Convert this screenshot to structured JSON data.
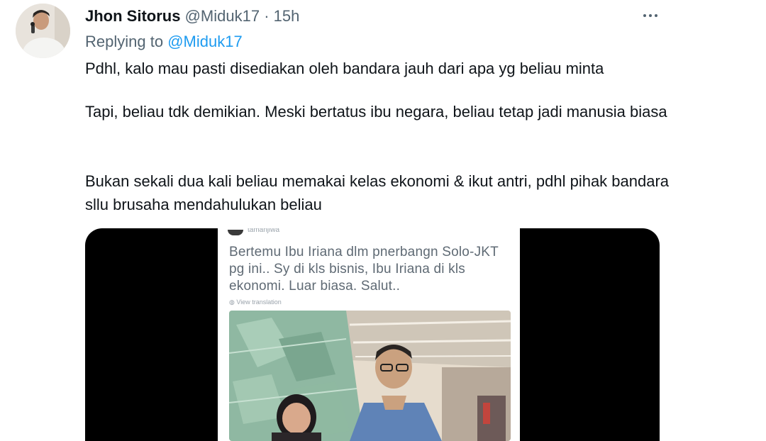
{
  "tweet": {
    "display_name": "Jhon Sitorus",
    "handle": "@Miduk17",
    "separator": "·",
    "time": "15h",
    "more_icon": "more-horizontal-icon",
    "replying_label": "Replying to",
    "replying_handle": "@Miduk17",
    "paragraphs": [
      "Pdhl, kalo mau pasti disediakan oleh bandara jauh dari apa yg beliau minta",
      "Tapi, beliau tdk demikian. Meski bertatus ibu negara, beliau tetap jadi manusia biasa",
      "Bukan sekali dua kali beliau memakai kelas ekonomi & ikut antri, pdhl pihak bandara sllu brusaha mendahulukan beliau"
    ]
  },
  "media": {
    "embedded_tweet": {
      "username": "tamanjiwa",
      "text": "Bertemu Ibu Iriana dlm pnerbangn Solo-JKT pg ini.. Sy di kls bisnis, Ibu Iriana di kls ekonomi. Luar biasa. Salut..",
      "translate_label": "View translation"
    }
  },
  "colors": {
    "text": "#0f1419",
    "muted": "#536471",
    "link": "#1d9bf0",
    "media_bg": "#000000"
  }
}
